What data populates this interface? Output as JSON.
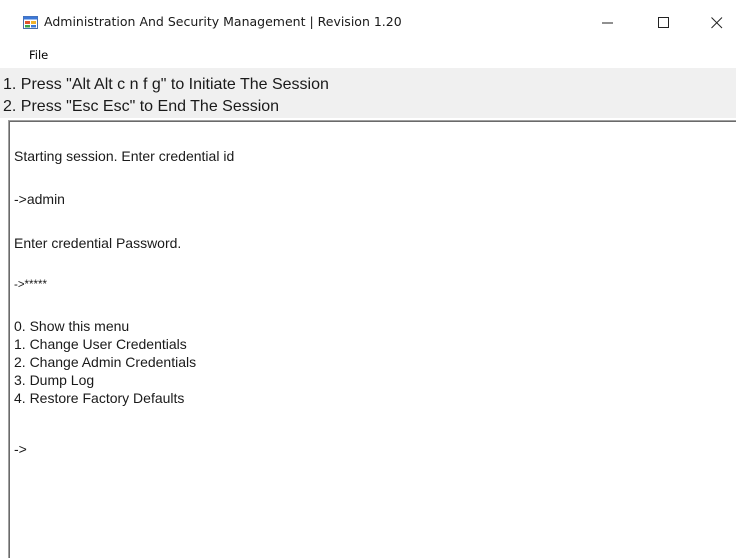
{
  "window": {
    "title": "Administration And Security Management  |  Revision 1.20",
    "controls": {
      "minimize": "—",
      "maximize": "☐",
      "close": "✕"
    }
  },
  "menu": {
    "items": [
      "File"
    ]
  },
  "instructions": [
    "1. Press \"Alt Alt c n f g\" to Initiate The Session",
    "2. Press \"Esc Esc\" to End The Session"
  ],
  "console": {
    "lines": [
      "Starting session. Enter credential id",
      "->admin",
      "Enter credential Password.",
      "->*****",
      "0.  Show this menu",
      "1.  Change User Credentials",
      "2.  Change Admin Credentials",
      "3.  Dump Log",
      "4.  Restore Factory Defaults",
      "->"
    ]
  }
}
